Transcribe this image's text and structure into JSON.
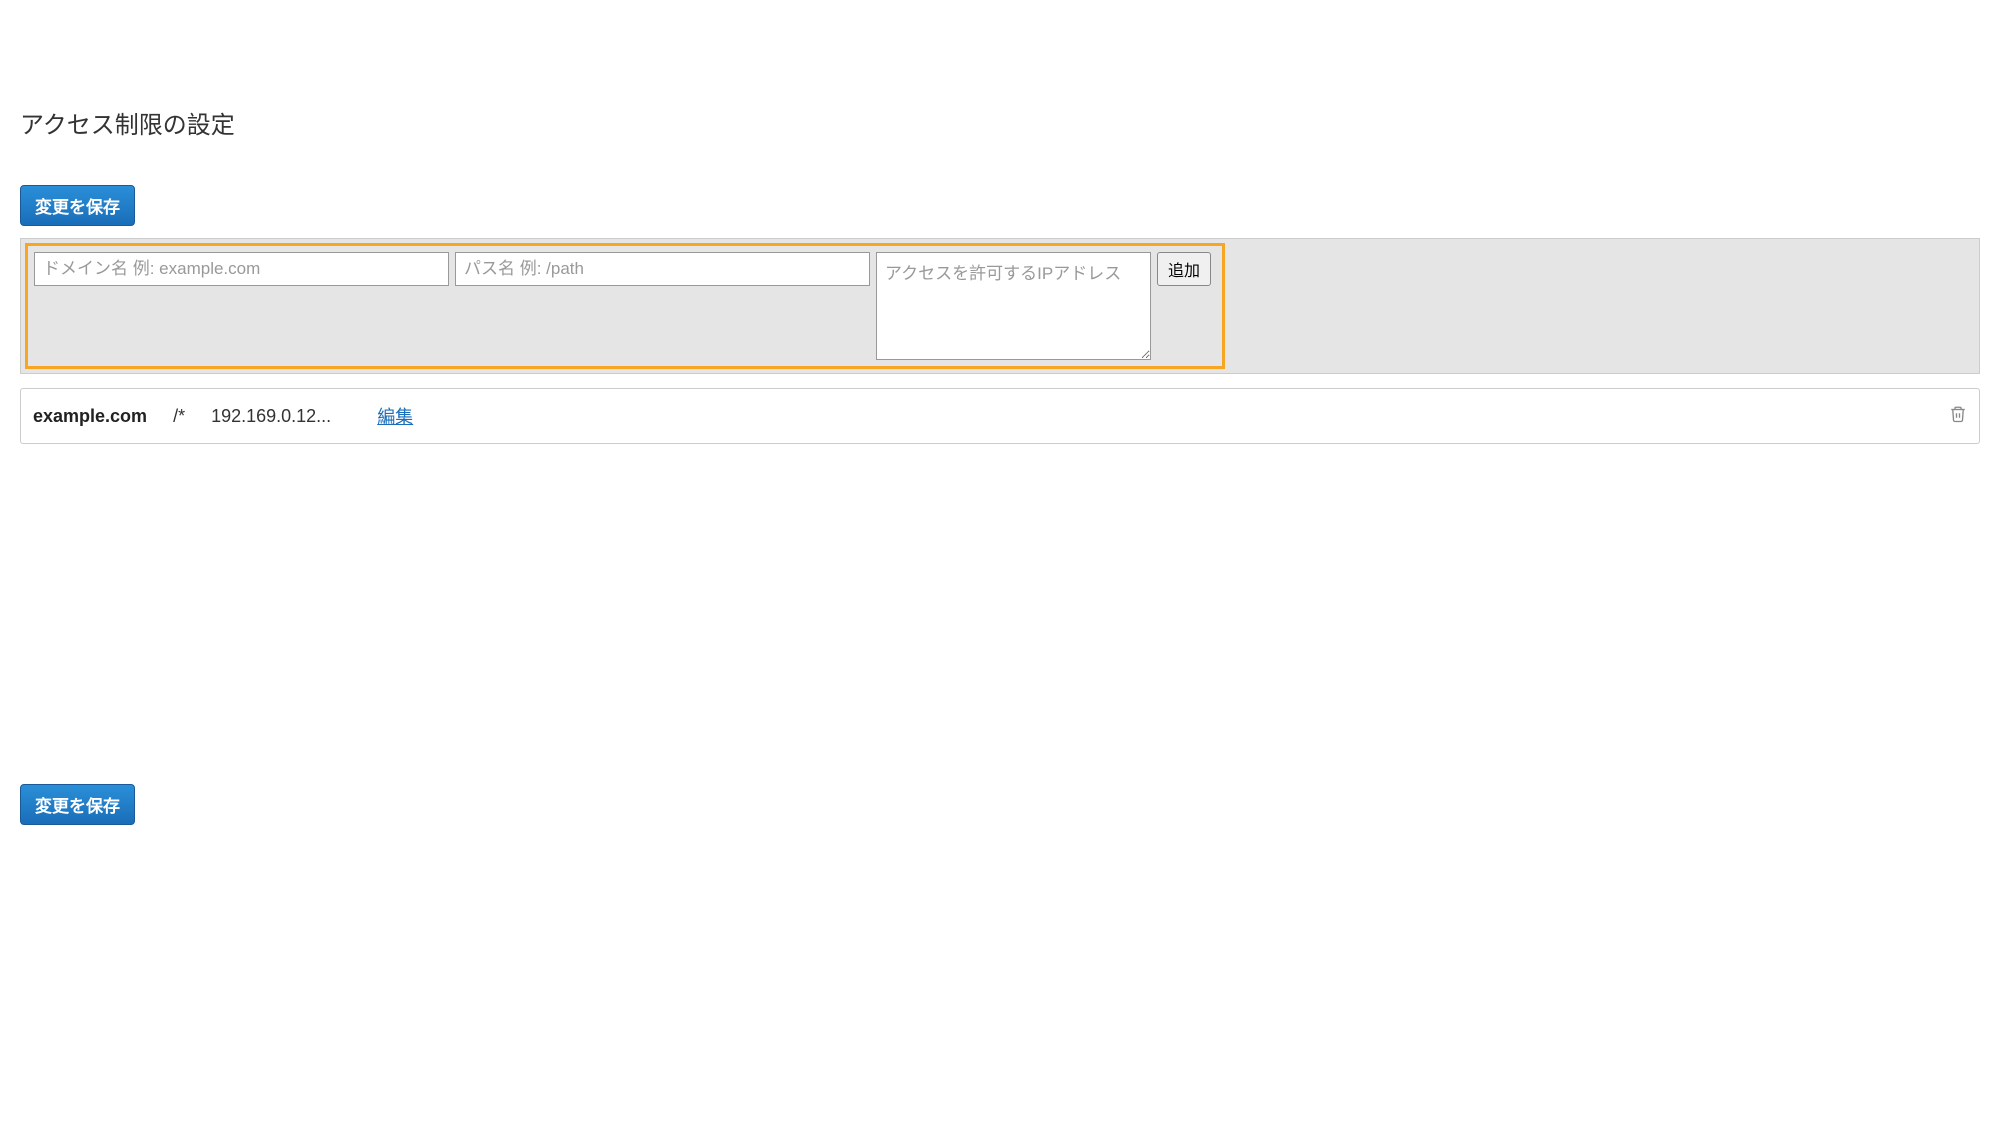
{
  "page": {
    "title": "アクセス制限の設定"
  },
  "buttons": {
    "save": "変更を保存",
    "add": "追加"
  },
  "form": {
    "domain_placeholder": "ドメイン名 例: example.com",
    "path_placeholder": "パス名 例: /path",
    "ip_placeholder": "アクセスを許可するIPアドレス"
  },
  "rules": [
    {
      "domain": "example.com",
      "path": "/*",
      "ip": "192.169.0.12...",
      "edit_label": "編集"
    }
  ]
}
